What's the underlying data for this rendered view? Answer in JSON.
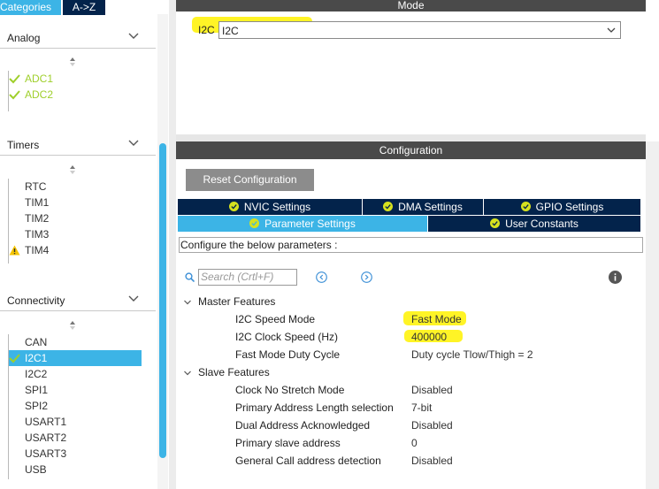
{
  "sidebar": {
    "tabs": {
      "categories": "Categories",
      "az": "A->Z"
    },
    "sections": {
      "analog": {
        "title": "Analog",
        "items": [
          "ADC1",
          "ADC2"
        ]
      },
      "timers": {
        "title": "Timers",
        "items": [
          "RTC",
          "TIM1",
          "TIM2",
          "TIM3",
          "TIM4"
        ]
      },
      "connectivity": {
        "title": "Connectivity",
        "items": [
          "CAN",
          "I2C1",
          "I2C2",
          "SPI1",
          "SPI2",
          "USART1",
          "USART2",
          "USART3",
          "USB"
        ]
      }
    }
  },
  "mode": {
    "header": "Mode",
    "label": "I2C",
    "selected": "I2C"
  },
  "config": {
    "header": "Configuration",
    "reset_button": "Reset Configuration",
    "tabs": {
      "nvic": "NVIC Settings",
      "dma": "DMA Settings",
      "gpio": "GPIO Settings",
      "parameter": "Parameter Settings",
      "user": "User Constants"
    },
    "description": "Configure the below parameters :",
    "search_placeholder": "Search (Crtl+F)",
    "groups": {
      "master": {
        "title": "Master Features",
        "params": [
          {
            "name": "I2C Speed Mode",
            "value": "Fast Mode"
          },
          {
            "name": "I2C Clock Speed (Hz)",
            "value": "400000"
          },
          {
            "name": "Fast Mode Duty Cycle",
            "value": "Duty cycle Tlow/Thigh = 2"
          }
        ]
      },
      "slave": {
        "title": "Slave Features",
        "params": [
          {
            "name": "Clock No Stretch Mode",
            "value": "Disabled"
          },
          {
            "name": "Primary Address Length selection",
            "value": "7-bit"
          },
          {
            "name": "Dual Address Acknowledged",
            "value": "Disabled"
          },
          {
            "name": "Primary slave address",
            "value": "0"
          },
          {
            "name": "General Call address detection",
            "value": "Disabled"
          }
        ]
      }
    }
  },
  "colors": {
    "dark_navy": "#03234b",
    "accent_blue": "#3cb4e6",
    "enabled_green": "#9fcf2b",
    "warning_yellow": "#f5c400",
    "highlight_yellow": "#fff200",
    "panel_header_gray": "#4a4a4a"
  },
  "icons": {
    "check": "check-icon",
    "warning": "warning-icon",
    "chevron": "chevron-down-icon",
    "search": "search-icon",
    "info": "info-icon",
    "prev": "previous-icon",
    "next": "next-icon",
    "sort": "sort-icon"
  }
}
